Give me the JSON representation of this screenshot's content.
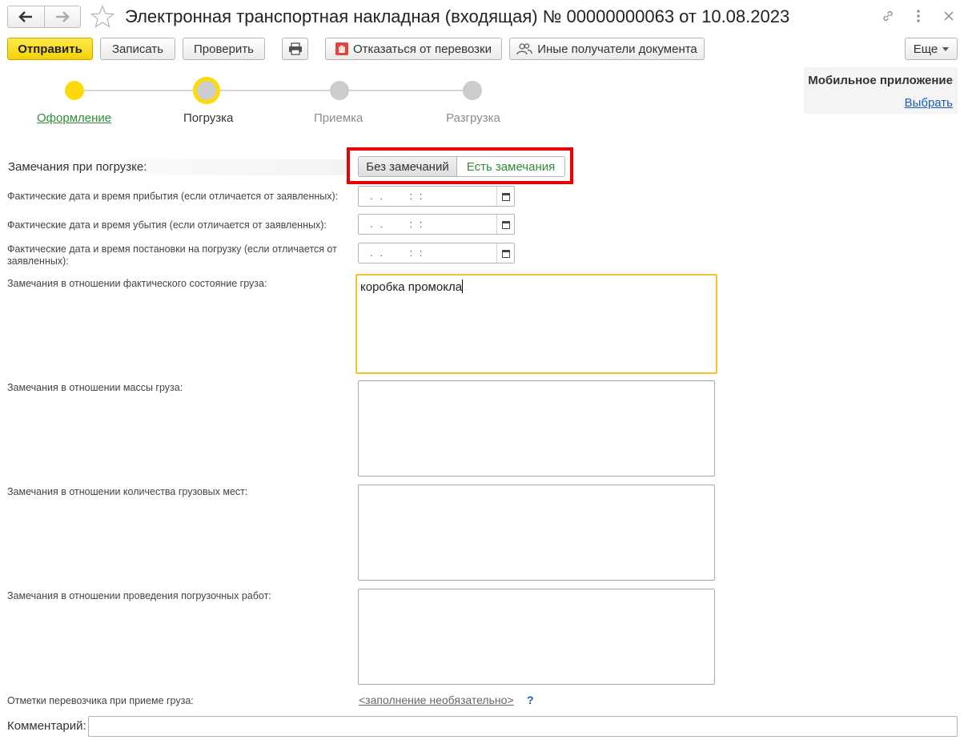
{
  "window": {
    "title": "Электронная транспортная накладная (входящая) № 00000000063 от 10.08.2023"
  },
  "toolbar": {
    "send": "Отправить",
    "save": "Записать",
    "check": "Проверить",
    "refuse": "Отказаться от перевозки",
    "other_recipients": "Иные получатели документа",
    "more": "Еще"
  },
  "steps": [
    {
      "label": "Оформление",
      "state": "done"
    },
    {
      "label": "Погрузка",
      "state": "current"
    },
    {
      "label": "Приемка",
      "state": "pending"
    },
    {
      "label": "Разгрузка",
      "state": "pending"
    }
  ],
  "mobile": {
    "title": "Мобильное приложение",
    "link": "Выбрать"
  },
  "form": {
    "remarks_label": "Замечания при погрузке:",
    "toggle": {
      "option_none": "Без замечаний",
      "option_has": "Есть замечания",
      "selected": "Есть замечания"
    },
    "arrival_label": "Фактические дата и время прибытия (если отличается от заявленных):",
    "departure_label": "Фактические дата и время убытия (если отличается от заявленных):",
    "loading_label": "Фактические дата и время постановки на погрузку (если отличается от заявленных):",
    "date_mask": " .  .        :  :",
    "condition_label": "Замечания в отношении фактического состояние груза:",
    "condition_value": "коробка промокла",
    "mass_label": "Замечания в отношении массы груза:",
    "mass_value": "",
    "places_label": "Замечания в отношении количества грузовых мест:",
    "places_value": "",
    "works_label": "Замечания в отношении проведения погрузочных работ:",
    "works_value": "",
    "carrier_marks_label": "Отметки перевозчика при приеме груза:",
    "carrier_marks_link": "<заполнение необязательно>",
    "help": "?",
    "comment_label": "Комментарий:",
    "comment_value": ""
  },
  "colors": {
    "accent_yellow": "#ffd80a",
    "link_green": "#2e8b3c",
    "link_blue": "#1a5fb4",
    "highlight_red": "#ee0000"
  }
}
